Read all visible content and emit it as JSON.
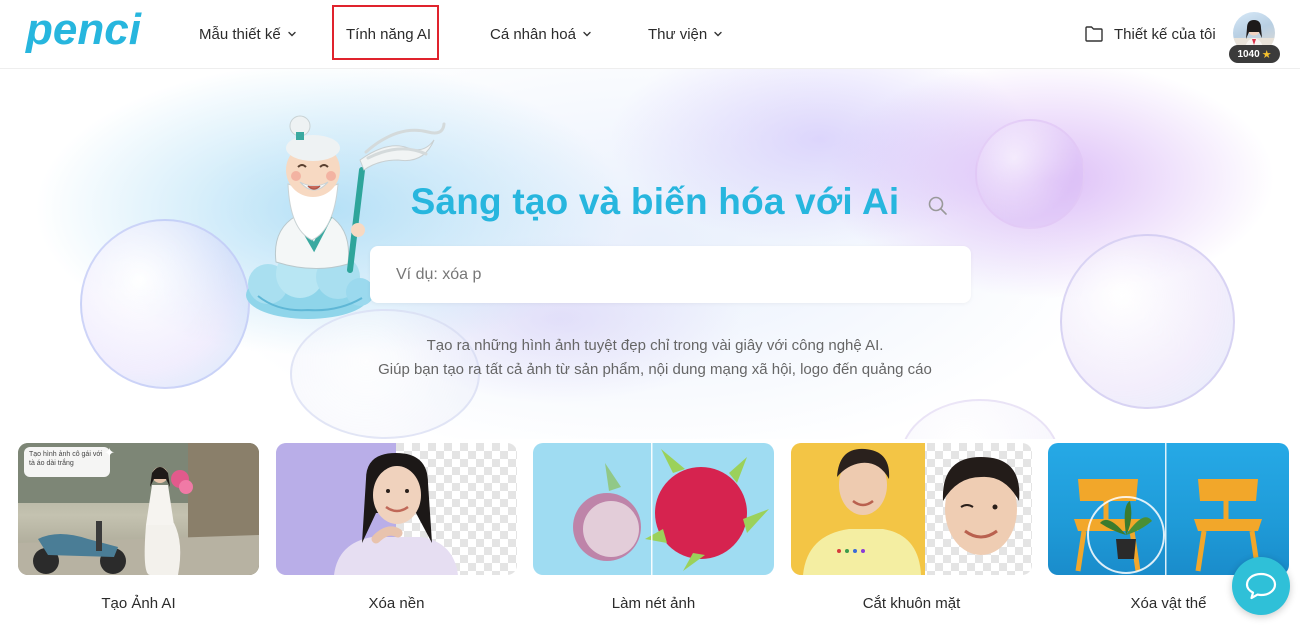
{
  "brand": {
    "logo_text": "penci",
    "color": "#27b6de"
  },
  "nav": {
    "items": [
      {
        "label": "Mẫu thiết kế",
        "has_dropdown": true
      },
      {
        "label": "Tính năng AI",
        "has_dropdown": false,
        "highlighted": true
      },
      {
        "label": "Cá nhân hoá",
        "has_dropdown": true
      },
      {
        "label": "Thư viện",
        "has_dropdown": true
      }
    ],
    "highlight_color": "#e0232d"
  },
  "user": {
    "my_designs_label": "Thiết kế của tôi",
    "points": "1040",
    "points_icon": "star-icon"
  },
  "hero": {
    "title": "Sáng tạo và biến hóa với Ai",
    "title_color": "#27b6de",
    "search_placeholder": "Ví dụ: xóa p",
    "search_icon": "search-icon",
    "subtitle_line1": "Tạo ra những hình ảnh tuyệt đẹp chỉ trong vài giây với công nghệ AI.",
    "subtitle_line2": "Giúp bạn tạo ra tất cả ảnh từ sản phẩm, nội dung mạng xã hội, logo đến quảng cáo"
  },
  "features": [
    {
      "label": "Tạo Ảnh AI",
      "bubble_text": "Tạo hình ảnh cô gái với tà áo dài trắng"
    },
    {
      "label": "Xóa nền"
    },
    {
      "label": "Làm nét ảnh"
    },
    {
      "label": "Cắt khuôn mặt"
    },
    {
      "label": "Xóa vật thể"
    }
  ],
  "chat": {
    "icon": "chat-icon",
    "color": "#2fc0d8"
  }
}
